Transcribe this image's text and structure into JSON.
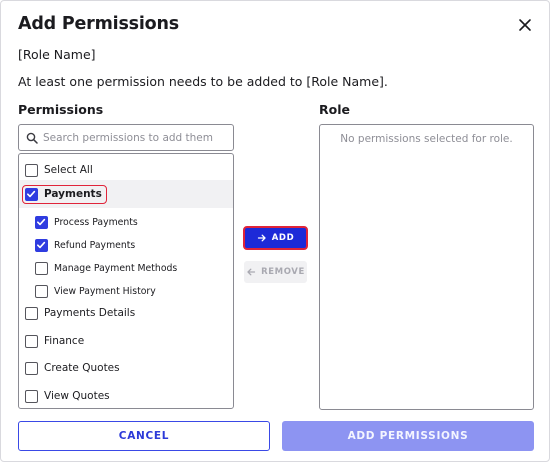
{
  "dialog": {
    "title": "Add Permissions",
    "role_name": "[Role Name]",
    "description": "At least one permission needs to be added to [Role Name]."
  },
  "permissions": {
    "label": "Permissions",
    "search_placeholder": "Search permissions to add them",
    "select_all": "Select All",
    "items": [
      {
        "label": "Payments",
        "checked": true
      },
      {
        "label": "Process Payments",
        "checked": true
      },
      {
        "label": "Refund Payments",
        "checked": true
      },
      {
        "label": "Manage Payment Methods",
        "checked": false
      },
      {
        "label": "View Payment History",
        "checked": false
      },
      {
        "label": "Payments Details",
        "checked": false
      },
      {
        "label": "Finance",
        "checked": false
      },
      {
        "label": "Create Quotes",
        "checked": false
      },
      {
        "label": "View Quotes",
        "checked": false
      }
    ]
  },
  "role": {
    "label": "Role",
    "empty_text": "No permissions selected for role."
  },
  "actions": {
    "add": "ADD",
    "remove": "REMOVE",
    "cancel": "CANCEL",
    "add_permissions": "ADD PERMISSIONS"
  },
  "colors": {
    "accent": "#1d2ad8",
    "checkbox": "#2f3ce0",
    "highlight": "#e0243a",
    "disabled_primary": "#8d94f2"
  }
}
